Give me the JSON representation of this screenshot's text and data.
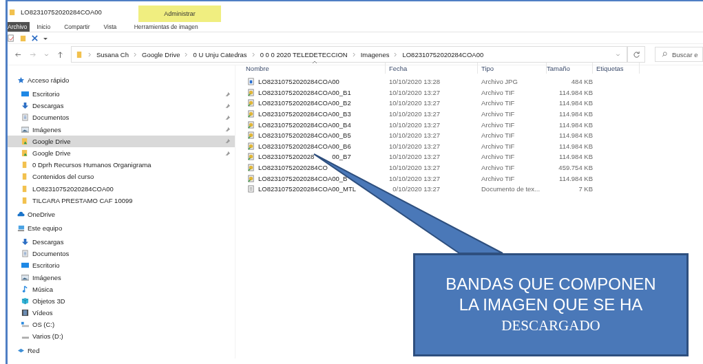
{
  "window": {
    "title": "LO82310752020284COA00"
  },
  "context_tab": {
    "group": "Administrar",
    "label": "Herramientas de imagen"
  },
  "ribbon_tabs": [
    {
      "label": "Archivo",
      "selected": true
    },
    {
      "label": "Inicio",
      "selected": false
    },
    {
      "label": "Compartir",
      "selected": false
    },
    {
      "label": "Vista",
      "selected": false
    }
  ],
  "address": {
    "path": [
      "Susana Ch",
      "Google Drive",
      "0 U Unju Catedras",
      "0 0 0 2020 TELEDETECCION",
      "Imagenes",
      "LO82310752020284COA00"
    ]
  },
  "search": {
    "placeholder": "Buscar e"
  },
  "sidebar": [
    {
      "label": "Acceso rápido",
      "kind": "star",
      "children": [
        {
          "label": "Escritorio",
          "kind": "desktop",
          "pinned": true,
          "selected": false
        },
        {
          "label": "Descargas",
          "kind": "download",
          "pinned": true,
          "selected": false
        },
        {
          "label": "Documentos",
          "kind": "document",
          "pinned": true,
          "selected": false
        },
        {
          "label": "Imágenes",
          "kind": "images",
          "pinned": true,
          "selected": false
        },
        {
          "label": "Google Drive",
          "kind": "drive-folder",
          "pinned": true,
          "selected": true
        },
        {
          "label": "Google Drive",
          "kind": "drive-folder",
          "pinned": true,
          "selected": false
        },
        {
          "label": "0 Dprh Recursos Humanos Organigrama",
          "kind": "folder",
          "pinned": false,
          "selected": false
        },
        {
          "label": "Contenidos del curso",
          "kind": "folder",
          "pinned": false,
          "selected": false
        },
        {
          "label": "LO82310752020284COA00",
          "kind": "folder",
          "pinned": false,
          "selected": false
        },
        {
          "label": "TILCARA PRESTAMO CAF 10099",
          "kind": "folder",
          "pinned": false,
          "selected": false
        }
      ]
    },
    {
      "label": "OneDrive",
      "kind": "cloud"
    },
    {
      "label": "Este equipo",
      "kind": "computer",
      "children": [
        {
          "label": "Descargas",
          "kind": "download",
          "pinned": false,
          "selected": false
        },
        {
          "label": "Documentos",
          "kind": "document",
          "pinned": false,
          "selected": false
        },
        {
          "label": "Escritorio",
          "kind": "desktop",
          "pinned": false,
          "selected": false
        },
        {
          "label": "Imágenes",
          "kind": "images",
          "pinned": false,
          "selected": false
        },
        {
          "label": "Música",
          "kind": "music",
          "pinned": false,
          "selected": false
        },
        {
          "label": "Objetos 3D",
          "kind": "cube",
          "pinned": false,
          "selected": false
        },
        {
          "label": "Vídeos",
          "kind": "video",
          "pinned": false,
          "selected": false
        },
        {
          "label": "OS (C:)",
          "kind": "os-drive",
          "pinned": false,
          "selected": false
        },
        {
          "label": "Varios (D:)",
          "kind": "drive",
          "pinned": false,
          "selected": false
        }
      ]
    },
    {
      "label": "Red",
      "kind": "network"
    }
  ],
  "table": {
    "columns": [
      "Nombre",
      "Fecha",
      "Tipo",
      "Tamaño",
      "Etiquetas"
    ],
    "rows": [
      {
        "name": "LO82310752020284COA00",
        "date": "10/10/2020 13:28",
        "type": "Archivo JPG",
        "size": "484 KB",
        "kind": "jpg"
      },
      {
        "name": "LO82310752020284COA00_B1",
        "date": "10/10/2020 13:27",
        "type": "Archivo TIF",
        "size": "114.984 KB",
        "kind": "tif"
      },
      {
        "name": "LO82310752020284COA00_B2",
        "date": "10/10/2020 13:27",
        "type": "Archivo TIF",
        "size": "114.984 KB",
        "kind": "tif"
      },
      {
        "name": "LO82310752020284COA00_B3",
        "date": "10/10/2020 13:27",
        "type": "Archivo TIF",
        "size": "114.984 KB",
        "kind": "tif"
      },
      {
        "name": "LO82310752020284COA00_B4",
        "date": "10/10/2020 13:27",
        "type": "Archivo TIF",
        "size": "114.984 KB",
        "kind": "tif"
      },
      {
        "name": "LO82310752020284COA00_B5",
        "date": "10/10/2020 13:27",
        "type": "Archivo TIF",
        "size": "114.984 KB",
        "kind": "tif"
      },
      {
        "name": "LO82310752020284COA00_B6",
        "date": "10/10/2020 13:27",
        "type": "Archivo TIF",
        "size": "114.984 KB",
        "kind": "tif"
      },
      {
        "name": "LO8231075202028",
        "name_tail": "00_B7",
        "date": "10/10/2020 13:27",
        "type": "Archivo TIF",
        "size": "114.984 KB",
        "kind": "tif"
      },
      {
        "name": "LO82310752020284CO",
        "date": "10/10/2020 13:27",
        "type": "Archivo TIF",
        "size": "459.754 KB",
        "kind": "tif"
      },
      {
        "name": "LO82310752020284COA00_B",
        "date": "10/10/2020 13:27",
        "type": "Archivo TIF",
        "size": "114.984 KB",
        "kind": "tif"
      },
      {
        "name": "LO82310752020284COA00_MTL",
        "date": "0/10/2020 13:27",
        "type": "Documento de tex...",
        "size": "7 KB",
        "kind": "txt"
      }
    ]
  },
  "callout": {
    "lines": [
      "BANDAS QUE COMPONEN",
      "LA IMAGEN QUE SE HA",
      "DESCARGADO"
    ]
  }
}
